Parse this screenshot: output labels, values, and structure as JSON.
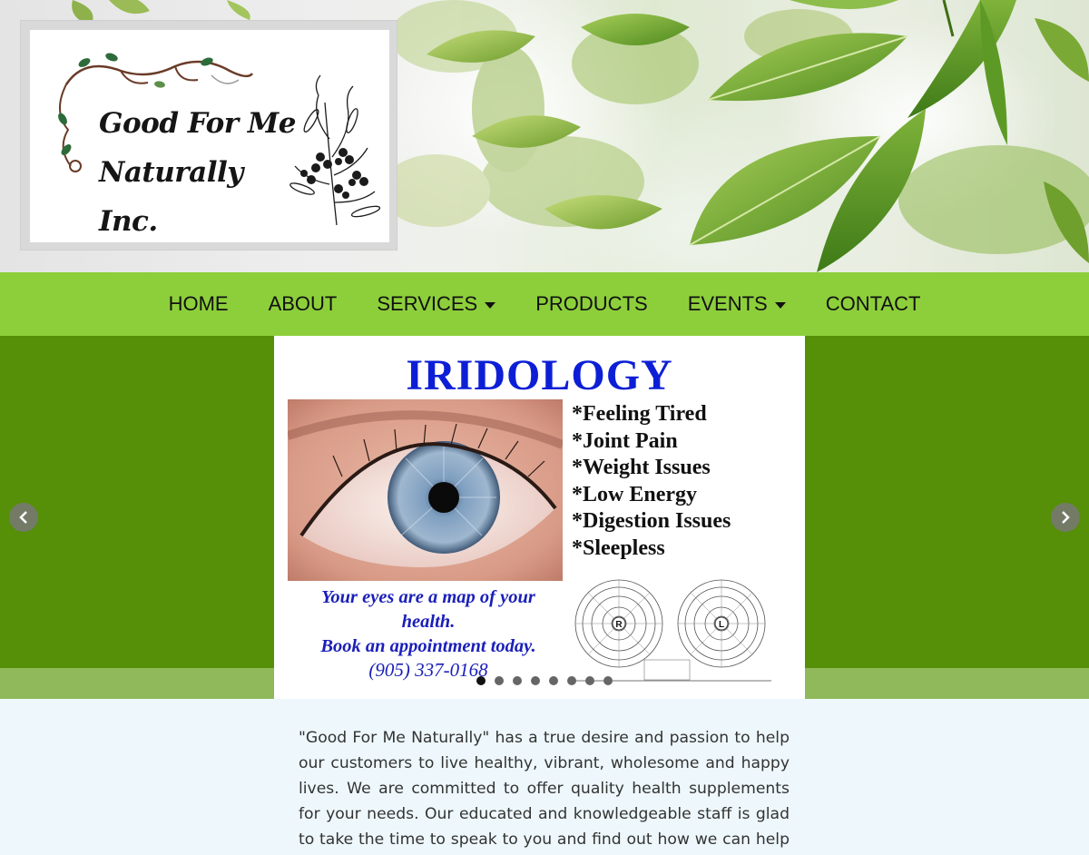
{
  "header": {
    "logo": {
      "line1": "Good For Me",
      "line2": "Naturally Inc."
    }
  },
  "nav": {
    "items": [
      {
        "label": "HOME",
        "dropdown": false
      },
      {
        "label": "ABOUT",
        "dropdown": false
      },
      {
        "label": "SERVICES",
        "dropdown": true
      },
      {
        "label": "PRODUCTS",
        "dropdown": false
      },
      {
        "label": "EVENTS",
        "dropdown": true
      },
      {
        "label": "CONTACT",
        "dropdown": false
      }
    ]
  },
  "slider": {
    "slide": {
      "title": "IRIDOLOGY",
      "bullets": [
        "*Feeling Tired",
        "*Joint Pain",
        "*Weight Issues",
        "*Low Energy",
        "*Digestion Issues",
        "*Sleepless"
      ],
      "tagline_line1": "Your eyes are a map of your",
      "tagline_line2": "health.",
      "tagline_line3": "Book an appointment today.",
      "phone": "(905) 337-0168",
      "chart_left_label": "R",
      "chart_right_label": "L"
    },
    "slide_count": 8,
    "active_index": 0,
    "prev_icon": "chevron-left-icon",
    "next_icon": "chevron-right-icon"
  },
  "intro": {
    "text": "\"Good For Me Naturally\" has a true desire and passion to help our customers to live healthy, vibrant, wholesome and happy lives. We are committed to offer quality health supplements for your needs. Our educated and knowledgeable staff is glad to take the time to speak to you and find out how we can help you. We find"
  },
  "colors": {
    "nav_bg": "#8dcf3b",
    "slider_bg": "#568f08",
    "slider_band": "#8fb95a",
    "page_bg": "#eef8fc",
    "slide_title": "#0d1fd6",
    "tagline": "#1a1fb8"
  }
}
